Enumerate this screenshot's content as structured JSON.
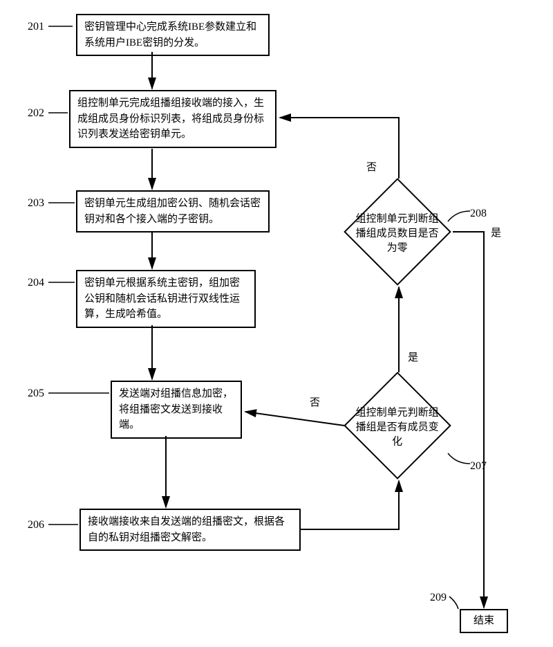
{
  "chart_data": {
    "type": "flowchart",
    "nodes": [
      {
        "id": "201",
        "type": "process",
        "text": "密钥管理中心完成系统IBE参数建立和系统用户IBE密钥的分发。"
      },
      {
        "id": "202",
        "type": "process",
        "text": "组控制单元完成组播组接收端的接入，生成组成员身份标识列表，将组成员身份标识列表发送给密钥单元。"
      },
      {
        "id": "203",
        "type": "process",
        "text": "密钥单元生成组加密公钥、随机会话密钥对和各个接入端的子密钥。"
      },
      {
        "id": "204",
        "type": "process",
        "text": "密钥单元根据系统主密钥，组加密公钥和随机会话私钥进行双线性运算，生成哈希值。"
      },
      {
        "id": "205",
        "type": "process",
        "text": "发送端对组播信息加密，将组播密文发送到接收端。"
      },
      {
        "id": "206",
        "type": "process",
        "text": "接收端接收来自发送端的组播密文，根据各自的私钥对组播密文解密。"
      },
      {
        "id": "207",
        "type": "decision",
        "text": "组控制单元判断组播组是否有成员变化"
      },
      {
        "id": "208",
        "type": "decision",
        "text": "组控制单元判断组播组成员数目是否为零"
      },
      {
        "id": "209",
        "type": "terminal",
        "text": "结束"
      }
    ],
    "edges": [
      {
        "from": "201",
        "to": "202"
      },
      {
        "from": "202",
        "to": "203"
      },
      {
        "from": "203",
        "to": "204"
      },
      {
        "from": "204",
        "to": "205"
      },
      {
        "from": "205",
        "to": "206"
      },
      {
        "from": "206",
        "to": "207"
      },
      {
        "from": "207",
        "to": "205",
        "label": "否"
      },
      {
        "from": "207",
        "to": "208",
        "label": "是"
      },
      {
        "from": "208",
        "to": "202",
        "label": "否"
      },
      {
        "from": "208",
        "to": "209",
        "label": "是"
      }
    ]
  },
  "labels": {
    "n201": "201",
    "n202": "202",
    "n203": "203",
    "n204": "204",
    "n205": "205",
    "n206": "206",
    "n207": "207",
    "n208": "208",
    "n209": "209"
  },
  "edge_labels": {
    "no": "否",
    "yes": "是"
  }
}
